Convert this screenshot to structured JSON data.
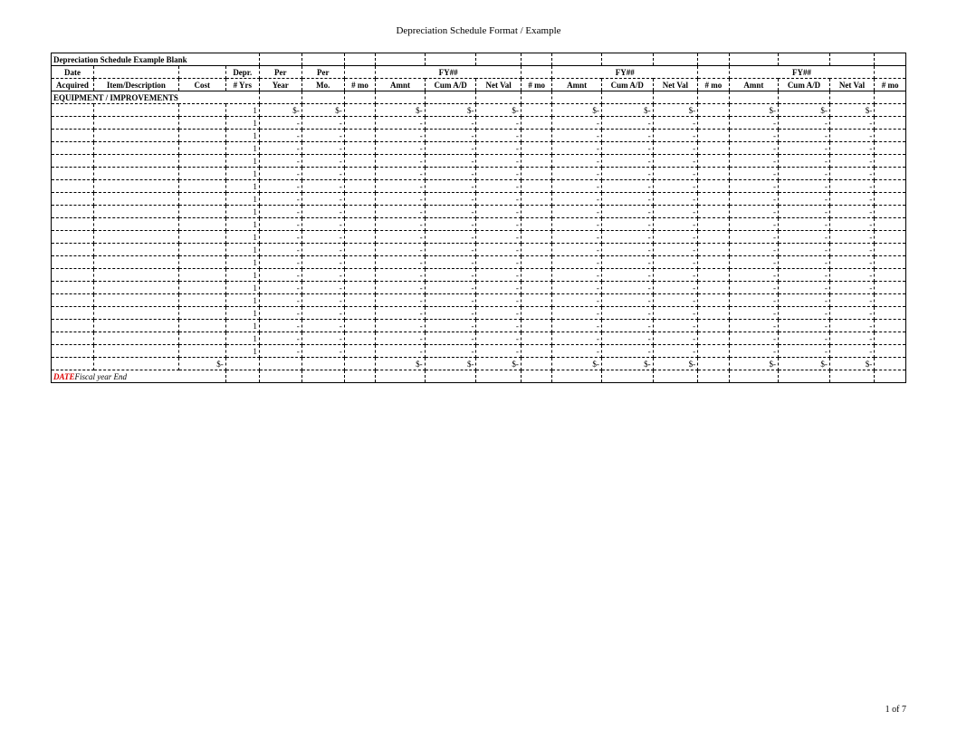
{
  "page_title": "Depreciation Schedule Format / Example",
  "table_title": "Depreciation Schedule Example Blank",
  "headers": {
    "row1": {
      "date": "Date",
      "depr": "Depr.",
      "per1": "Per",
      "per2": "Per",
      "fy": "FY##"
    },
    "row2": {
      "acquired": "Acquired",
      "item": "Item/Description",
      "cost": "Cost",
      "yrs": "# Yrs",
      "year": "Year",
      "mo": "Mo.",
      "nmo": "# mo",
      "amnt": "Amnt",
      "cum": "Cum A/D",
      "netval": "Net Val"
    }
  },
  "section_header": "EQUIPMENT / IMPROVEMENTS",
  "first_row": {
    "yrs": "1",
    "per_year": "$-",
    "per_mo": "$-",
    "amnt": "$-",
    "cum": "$-",
    "netval": "$-"
  },
  "data_rows_count": 20,
  "data_row": {
    "yrs": "1",
    "dash": "-"
  },
  "totals_row": {
    "cost": "$-",
    "amnt": "$-",
    "cum": "$-",
    "netval": "$-"
  },
  "footer_row": {
    "date": "DATE",
    "label": "Fiscal year End"
  },
  "page_number": "1 of 7"
}
